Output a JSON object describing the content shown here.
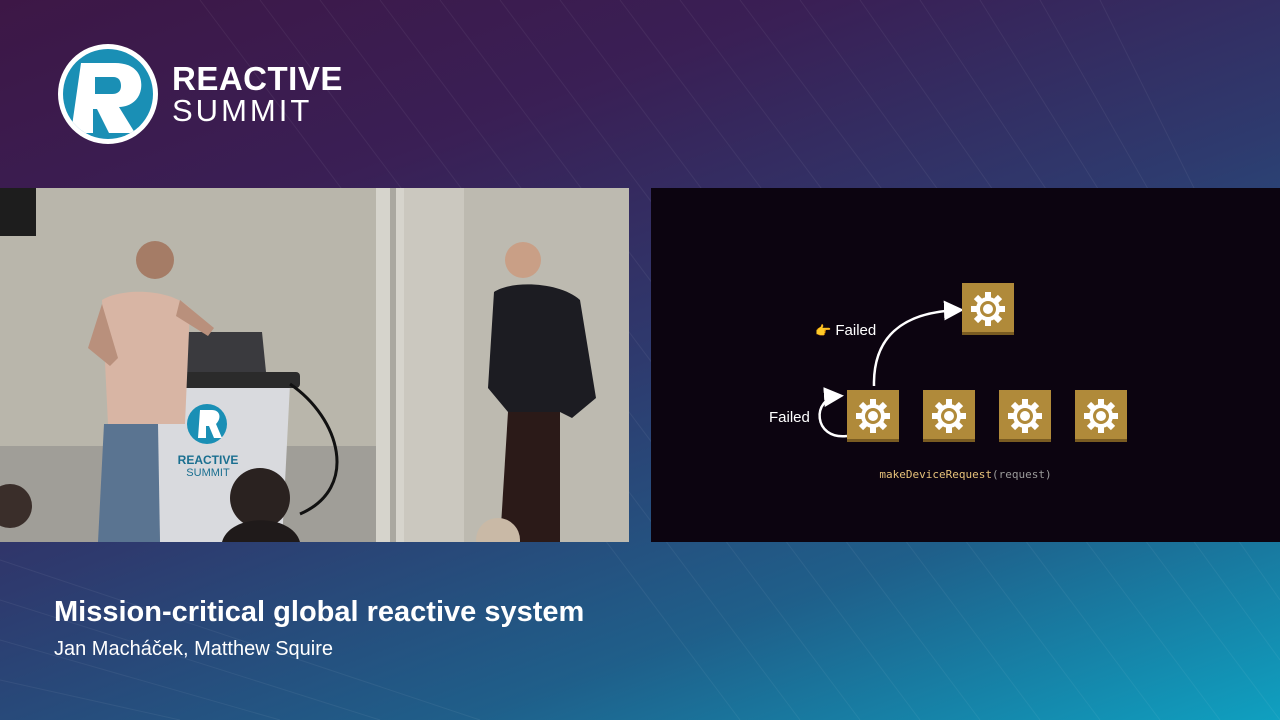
{
  "brand": {
    "line1": "REACTIVE",
    "line2": "SUMMIT"
  },
  "podium": {
    "line1": "REACTIVE",
    "line2": "SUMMIT"
  },
  "slide": {
    "label_upper": "Failed",
    "label_lower": "Failed",
    "pointer_emoji": "👉",
    "code_function": "makeDeviceRequest",
    "code_args": "(request)"
  },
  "talk": {
    "title": "Mission-critical global reactive system",
    "speakers": "Jan Macháček,  Matthew Squire"
  },
  "colors": {
    "gear": "#b08a3a",
    "slide_bg": "#0c0410",
    "code_fn": "#e7c27a"
  }
}
